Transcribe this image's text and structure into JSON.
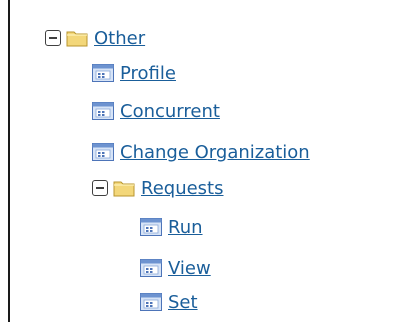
{
  "tree": {
    "folders": {
      "other": {
        "label": "Other",
        "expanded": true
      },
      "requests": {
        "label": "Requests",
        "expanded": true
      }
    },
    "other_items": [
      {
        "label": "Profile"
      },
      {
        "label": "Concurrent"
      },
      {
        "label": "Change Organization"
      }
    ],
    "request_items": [
      {
        "label": "Run"
      },
      {
        "label": "View"
      },
      {
        "label": "Set"
      }
    ]
  },
  "colors": {
    "link": "#1a5e9a",
    "folder_fill": "#f3d77a",
    "icon_frame": "#5b82c4"
  },
  "icons": {
    "collapse": "minus-square-icon",
    "folder": "folder-icon",
    "function": "function-window-icon"
  }
}
